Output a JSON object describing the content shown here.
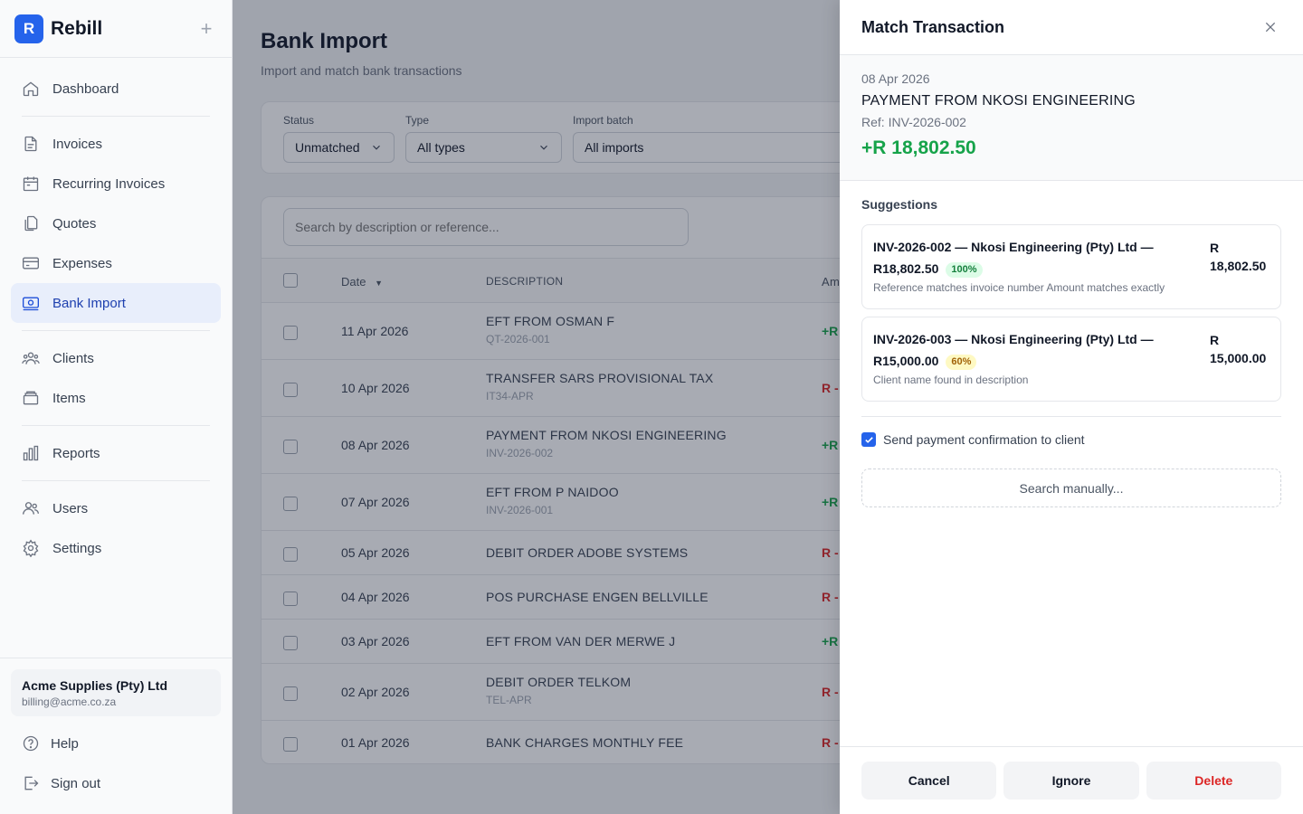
{
  "brand": {
    "logo_letter": "R",
    "name": "Rebill",
    "add_icon": "plus-icon"
  },
  "sidebar": {
    "nav": [
      {
        "label": "Dashboard",
        "icon": "home-icon"
      },
      {
        "label": "Invoices",
        "icon": "file-icon"
      },
      {
        "label": "Recurring Invoices",
        "icon": "calendar-icon"
      },
      {
        "label": "Quotes",
        "icon": "copy-icon"
      },
      {
        "label": "Expenses",
        "icon": "credit-card-icon"
      },
      {
        "label": "Bank Import",
        "icon": "bank-icon",
        "active": true
      },
      {
        "label": "Clients",
        "icon": "clients-icon"
      },
      {
        "label": "Items",
        "icon": "box-icon"
      },
      {
        "label": "Reports",
        "icon": "chart-icon"
      },
      {
        "label": "Users",
        "icon": "users-icon"
      },
      {
        "label": "Settings",
        "icon": "gear-icon"
      }
    ],
    "account": {
      "name": "Acme Supplies (Pty) Ltd",
      "email": "billing@acme.co.za"
    },
    "help_label": "Help",
    "signout_label": "Sign out"
  },
  "page": {
    "title": "Bank Import",
    "subtitle": "Import and match bank transactions",
    "filters": {
      "status": {
        "label": "Status",
        "value": "Unmatched"
      },
      "type": {
        "label": "Type",
        "value": "All types"
      },
      "batch": {
        "label": "Import batch",
        "value": "All imports"
      }
    },
    "search_placeholder": "Search by description or reference...",
    "columns": {
      "date": "Date",
      "description": "DESCRIPTION",
      "amount": "Am"
    },
    "rows": [
      {
        "date": "11 Apr 2026",
        "description": "EFT FROM OSMAN F",
        "ref": "QT-2026-001",
        "amount": "+R",
        "kind": "pos"
      },
      {
        "date": "10 Apr 2026",
        "description": "TRANSFER SARS PROVISIONAL TAX",
        "ref": "IT34-APR",
        "amount": "R -",
        "kind": "neg"
      },
      {
        "date": "08 Apr 2026",
        "description": "PAYMENT FROM NKOSI ENGINEERING",
        "ref": "INV-2026-002",
        "amount": "+R",
        "kind": "pos"
      },
      {
        "date": "07 Apr 2026",
        "description": "EFT FROM P NAIDOO",
        "ref": "INV-2026-001",
        "amount": "+R",
        "kind": "pos"
      },
      {
        "date": "05 Apr 2026",
        "description": "DEBIT ORDER ADOBE SYSTEMS",
        "ref": "",
        "amount": "R -",
        "kind": "neg"
      },
      {
        "date": "04 Apr 2026",
        "description": "POS PURCHASE ENGEN BELLVILLE",
        "ref": "",
        "amount": "R -",
        "kind": "neg"
      },
      {
        "date": "03 Apr 2026",
        "description": "EFT FROM VAN DER MERWE J",
        "ref": "",
        "amount": "+R",
        "kind": "pos"
      },
      {
        "date": "02 Apr 2026",
        "description": "DEBIT ORDER TELKOM",
        "ref": "TEL-APR",
        "amount": "R -",
        "kind": "neg"
      },
      {
        "date": "01 Apr 2026",
        "description": "BANK CHARGES MONTHLY FEE",
        "ref": "",
        "amount": "R -",
        "kind": "neg"
      }
    ]
  },
  "drawer": {
    "title": "Match Transaction",
    "close_icon": "close-icon",
    "transaction": {
      "date": "08 Apr 2026",
      "description": "PAYMENT FROM NKOSI ENGINEERING",
      "reference": "Ref: INV-2026-002",
      "amount": "+R 18,802.50"
    },
    "suggestions_title": "Suggestions",
    "suggestions": [
      {
        "title": "INV-2026-002 — Nkosi Engineering (Pty) Ltd —",
        "amount_inline": "R18,802.50",
        "confidence": "100%",
        "reason": "Reference matches invoice number Amount matches exactly",
        "amount_currency": "R",
        "amount_value": "18,802.50"
      },
      {
        "title": "INV-2026-003 — Nkosi Engineering (Pty) Ltd —",
        "amount_inline": "R15,000.00",
        "confidence": "60%",
        "reason": "Client name found in description",
        "amount_currency": "R",
        "amount_value": "15,000.00"
      }
    ],
    "confirm_label": "Send payment confirmation to client",
    "confirm_checked": true,
    "manual_search_label": "Search manually...",
    "buttons": {
      "cancel": "Cancel",
      "ignore": "Ignore",
      "delete": "Delete"
    }
  }
}
